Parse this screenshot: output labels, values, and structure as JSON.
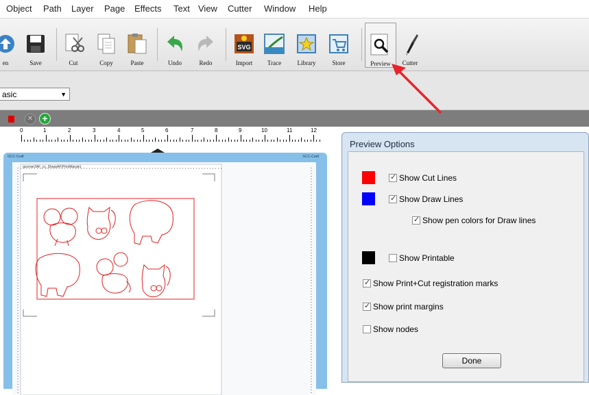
{
  "menu": [
    "Object",
    "Path",
    "Layer",
    "Page",
    "Effects",
    "Text",
    "View",
    "Cutter",
    "Window",
    "Help"
  ],
  "toolbar": {
    "items": [
      {
        "label": "en",
        "icon": "open-icon"
      },
      {
        "label": "Save",
        "icon": "save-icon"
      },
      {
        "label": "Cut",
        "icon": "scissors-icon"
      },
      {
        "label": "Copy",
        "icon": "copy-icon"
      },
      {
        "label": "Paste",
        "icon": "paste-icon"
      },
      {
        "label": "Undo",
        "icon": "undo-icon"
      },
      {
        "label": "Redo",
        "icon": "redo-icon"
      },
      {
        "label": "Import",
        "icon": "svg-import-icon"
      },
      {
        "label": "Trace",
        "icon": "trace-icon"
      },
      {
        "label": "Library",
        "icon": "library-icon"
      },
      {
        "label": "Store",
        "icon": "store-icon"
      },
      {
        "label": "Preview",
        "icon": "magnifier-icon"
      },
      {
        "label": "Cutter",
        "icon": "cutter-blade-icon"
      }
    ]
  },
  "stylebar": {
    "style_select": "asic"
  },
  "ruler": {
    "numbers": [
      "0",
      "1",
      "2",
      "3",
      "4",
      "5",
      "6",
      "7",
      "8",
      "9",
      "10",
      "11",
      "12"
    ]
  },
  "canvas": {
    "page_caption": "qcorner2AF_cc_SharpAF(PrintMargin)",
    "mat_label": "GCC-Craft"
  },
  "dialog": {
    "title": "Preview Options",
    "options": {
      "cut_lines": "Show Cut Lines",
      "draw_lines": "Show Draw Lines",
      "pen_colors": "Show pen colors for Draw lines",
      "printable": "Show Printable",
      "registration": "Show Print+Cut registration marks",
      "margins": "Show print margins",
      "nodes": "Show nodes"
    },
    "checked": {
      "cut_lines": true,
      "draw_lines": true,
      "pen_colors": true,
      "printable": false,
      "registration": true,
      "margins": true,
      "nodes": false
    },
    "swatch_colors": {
      "cut": "#ff0000",
      "draw": "#0000ff",
      "printable": "#000000"
    },
    "done_label": "Done"
  },
  "colors": {
    "accent_arrow": "#e8232b",
    "mat_blue": "#86c0e8",
    "cut_line": "#e8232b"
  }
}
